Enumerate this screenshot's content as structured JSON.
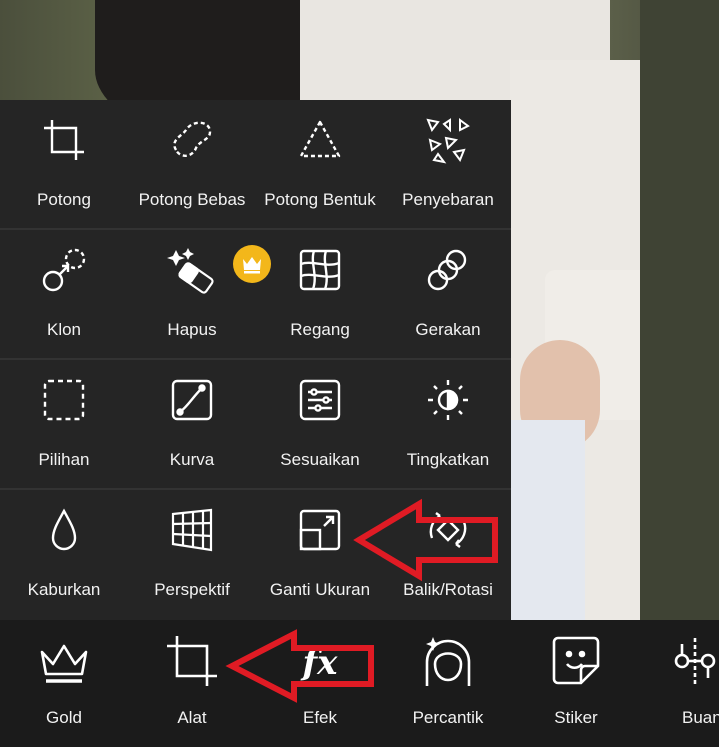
{
  "tools": {
    "rows": [
      [
        {
          "label": "Potong",
          "icon": "crop-icon"
        },
        {
          "label": "Potong Bebas",
          "icon": "freeform-cut-icon"
        },
        {
          "label": "Potong Bentuk",
          "icon": "shape-cut-icon"
        },
        {
          "label": "Penyebaran",
          "icon": "dispersion-icon"
        }
      ],
      [
        {
          "label": "Klon",
          "icon": "clone-icon"
        },
        {
          "label": "Hapus",
          "icon": "eraser-icon",
          "premium": true
        },
        {
          "label": "Regang",
          "icon": "stretch-icon"
        },
        {
          "label": "Gerakan",
          "icon": "motion-icon"
        }
      ],
      [
        {
          "label": "Pilihan",
          "icon": "selection-icon"
        },
        {
          "label": "Kurva",
          "icon": "curves-icon"
        },
        {
          "label": "Sesuaikan",
          "icon": "adjust-icon"
        },
        {
          "label": "Tingkatkan",
          "icon": "enhance-icon"
        }
      ],
      [
        {
          "label": "Kaburkan",
          "icon": "blur-icon"
        },
        {
          "label": "Perspektif",
          "icon": "perspective-icon"
        },
        {
          "label": "Ganti Ukuran",
          "icon": "resize-icon"
        },
        {
          "label": "Balik/Rotasi",
          "icon": "flip-rotate-icon"
        }
      ]
    ]
  },
  "bottom_tabs": [
    {
      "label": "Gold",
      "icon": "crown-icon"
    },
    {
      "label": "Alat",
      "icon": "crop-icon"
    },
    {
      "label": "Efek",
      "icon": "fx-icon"
    },
    {
      "label": "Percantik",
      "icon": "beautify-icon"
    },
    {
      "label": "Stiker",
      "icon": "sticker-icon"
    },
    {
      "label": "Buan",
      "icon": "cutout-icon"
    }
  ],
  "colors": {
    "panel_bg": "#252525",
    "bottom_bar_bg": "#1b1b1b",
    "premium_badge": "#f3b71a",
    "annotation_arrow": "#e01b24",
    "text": "#f2f2f2"
  }
}
